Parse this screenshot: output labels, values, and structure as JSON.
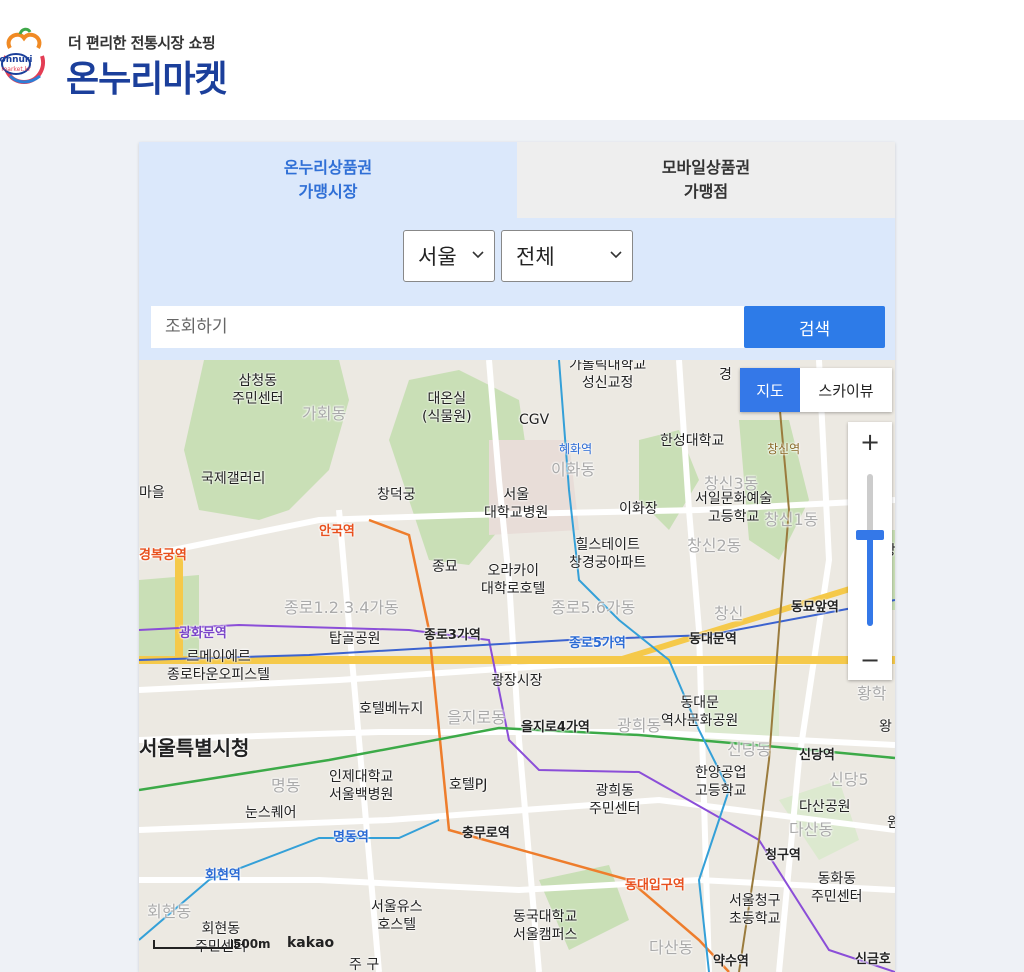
{
  "brand": {
    "tagline": "더 편리한 전통시장 쇼핑",
    "name": "온누리마켓",
    "logo_text": "onnuri market.kr"
  },
  "tabs": [
    {
      "line1": "온누리상품권",
      "line2": "가맹시장",
      "active": true
    },
    {
      "line1": "모바일상품권",
      "line2": "가맹점",
      "active": false
    }
  ],
  "filters": {
    "region": "서울",
    "district": "전체"
  },
  "search": {
    "placeholder": "조회하기",
    "button": "검색"
  },
  "map": {
    "type_buttons": [
      "지도",
      "스카이뷰"
    ],
    "active_type": "지도",
    "zoom_in": "+",
    "zoom_out": "−",
    "zoom_level_fraction": 0.4,
    "scale": "500m",
    "provider": "kakao",
    "labels": {
      "samcheong": "삼청동",
      "samcheong2": "주민센터",
      "gahoe": "가회동",
      "daeonsil": "대온실",
      "daeonsil2": "(식물원)",
      "cgv": "CGV",
      "catholic": "가톨릭대학교",
      "catholic2": "성신교정",
      "gyeong": "경",
      "hansung": "한성대학교",
      "gallery": "국제갤러리",
      "maeul": "마을",
      "changdeok": "창덕궁",
      "snuh": "서울",
      "snuh2": "대학교병원",
      "ihwa_dong": "이화동",
      "ihwajang": "이화장",
      "seoil": "서일문화예술",
      "seoil2": "고등학교",
      "changsin3": "창신3동",
      "changsin1": "창신1동",
      "jongmyo": "종묘",
      "hillstate": "힐스테이트",
      "hillstate2": "창경궁아파트",
      "changsin2": "창신2동",
      "orakai": "오라카이",
      "orakai2": "대학로호텔",
      "jongno1234": "종로1.2.3.4가동",
      "jongno56": "종로5.6가동",
      "changsin": "창신",
      "tapgol": "탑골공원",
      "remeier": "르메이에르",
      "remeier2": "종로타운오피스텔",
      "gwangjang": "광장시장",
      "ddp": "동대문",
      "ddp2": "역사문화공원",
      "hotel_benuji": "호텔베뉴지",
      "euljiro": "을지로동",
      "gwanghui_dist": "광희동",
      "city_hall": "서울특별시청",
      "inje": "인제대학교",
      "inje2": "서울백병원",
      "hotel_pj": "호텔PJ",
      "gwanghui": "광희동",
      "gwanghui2": "주민센터",
      "hanyang": "한양공업",
      "hanyang2": "고등학교",
      "sindang_dist": "신당동",
      "sindang5": "신당5",
      "myeong": "명동",
      "eunsquare": "눈스퀘어",
      "dasan_park": "다산공원",
      "dasan_dist": "다산동",
      "donghwa": "동화동",
      "donghwa2": "주민센터",
      "hoehyeon": "회현동",
      "hoehyeon_c": "회현동",
      "hoehyeon_c2": "주민센터",
      "youth": "서울유스",
      "youth2": "호스텔",
      "dongguk": "동국대학교",
      "dongguk2": "서울캠퍼스",
      "cheonggu_school": "서울청구",
      "cheonggu_school2": "초등학교",
      "dasan2": "다산동",
      "bottom": "주 구",
      "hoehwa_road": "혜화역",
      "changsin_road": "창신역",
      "hwang": "황학",
      "wang": "왕",
      "ang": "앙",
      "won": "원"
    },
    "stations": {
      "anguk": "안국역",
      "gyeongbok": "경복궁역",
      "gwanghwamun": "광화문역",
      "jongno3": "종로3가역",
      "jongno5": "종로5가역",
      "dongdaemun": "동대문역",
      "dongmyo": "동묘앞역",
      "euljiro4": "을지로4가역",
      "sindang": "신당역",
      "myeongdong": "명동역",
      "chungmuro": "충무로역",
      "cheonggu": "청구역",
      "hoehyeon": "회현역",
      "dongdaeipgu": "동대입구역",
      "yaksu": "약수역",
      "singeum": "신금호"
    }
  }
}
